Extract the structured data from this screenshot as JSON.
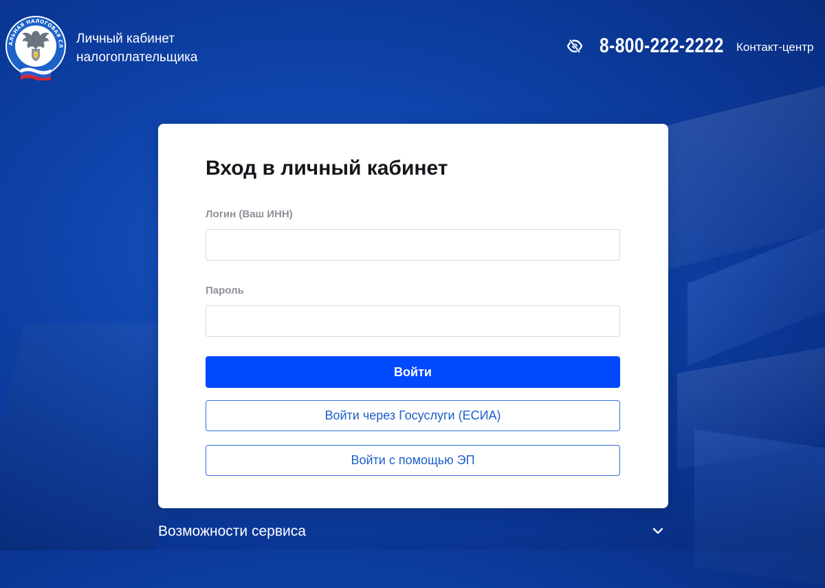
{
  "header": {
    "app_title_line1": "Личный кабинет",
    "app_title_line2": "налогоплательщика",
    "logo_ring_text": "ФЕДЕРАЛЬНАЯ НАЛОГОВАЯ СЛУЖБА",
    "logo_icon": "fns-emblem-logo",
    "accessibility_icon": "eye-accessibility-icon",
    "phone": "8-800-222-2222",
    "contact_center": "Контакт-центр"
  },
  "login": {
    "title": "Вход в личный кабинет",
    "login_label": "Логин (Ваш ИНН)",
    "login_value": "",
    "password_label": "Пароль",
    "password_value": "",
    "submit_label": "Войти",
    "gosuslugi_label": "Войти через Госуслуги (ЕСИА)",
    "ep_label": "Войти с помощью ЭП"
  },
  "features": {
    "label": "Возможности сервиса",
    "expand_icon": "chevron-down-icon"
  },
  "colors": {
    "background": "#0e43aa",
    "primary_button": "#0049ff",
    "outline_button_border": "#2f6fd8",
    "outline_button_text": "#1b5fc8",
    "card": "#ffffff",
    "label_text": "#8d9197"
  }
}
